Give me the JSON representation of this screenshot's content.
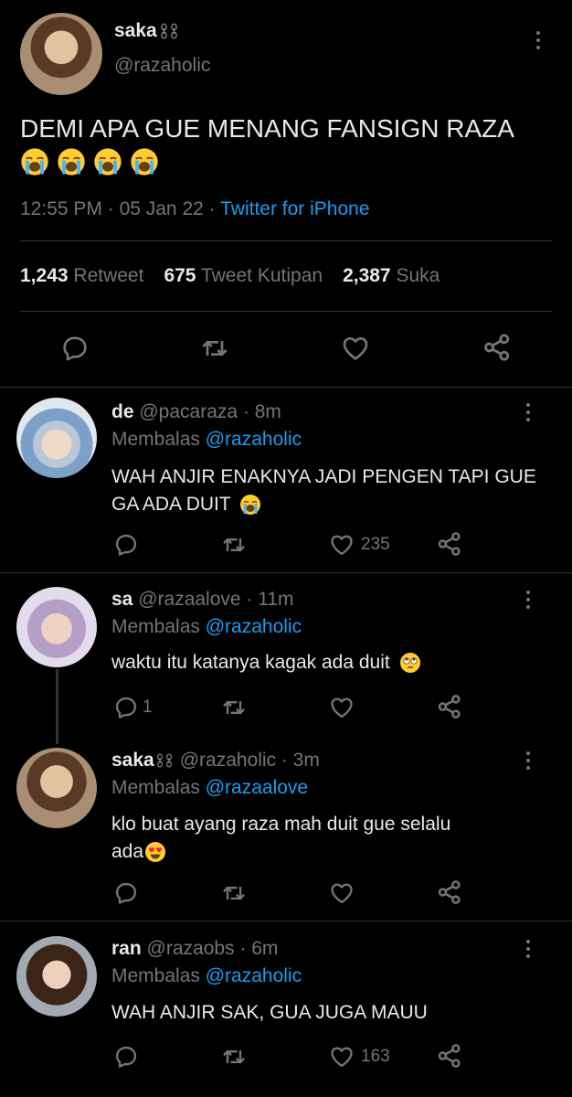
{
  "main_tweet": {
    "display_name": "saka",
    "handle": "@razaholic",
    "text": "DEMI APA GUE MENANG FANSIGN RAZA",
    "time": "12:55 PM",
    "date": "05 Jan 22",
    "client": "Twitter for iPhone",
    "stats": {
      "retweets": "1,243",
      "retweets_label": "Retweet",
      "quotes": "675",
      "quotes_label": "Tweet Kutipan",
      "likes": "2,387",
      "likes_label": "Suka"
    }
  },
  "replies": [
    {
      "display_name": "de",
      "handle": "@pacaraza",
      "age": "8m",
      "replying_label": "Membalas",
      "replying_to": "@razaholic",
      "text": "WAH ANJIR ENAKNYA JADI PENGEN TAPI GUE GA ADA DUIT",
      "reply_count": "",
      "like_count": "235"
    },
    {
      "display_name": "sa",
      "handle": "@razaalove",
      "age": "11m",
      "replying_label": "Membalas",
      "replying_to": "@razaholic",
      "text": "waktu itu katanya kagak ada duit",
      "reply_count": "1",
      "like_count": ""
    },
    {
      "display_name": "saka",
      "handle": "@razaholic",
      "age": "3m",
      "replying_label": "Membalas",
      "replying_to": "@razaalove",
      "text_line1": "klo buat ayang raza mah duit gue selalu",
      "text_line2": "ada",
      "reply_count": "",
      "like_count": ""
    },
    {
      "display_name": "ran",
      "handle": "@razaobs",
      "age": "6m",
      "replying_label": "Membalas",
      "replying_to": "@razaholic",
      "text": "WAH ANJIR SAK, GUA JUGA MAUU",
      "reply_count": "",
      "like_count": "163"
    }
  ],
  "icons": {
    "reply": "reply-icon",
    "retweet": "retweet-icon",
    "like": "heart-icon",
    "share": "share-icon",
    "more": "more-icon",
    "crying": "loudly-crying-face-emoji",
    "eye_roll": "eye-roll-emoji",
    "heart_eyes": "heart-eyes-emoji",
    "chain": "chain-icon"
  },
  "colors": {
    "background": "#000000",
    "text": "#e7e9ea",
    "muted": "#71767b",
    "link": "#1d9bf0",
    "divider": "#2f3336"
  }
}
